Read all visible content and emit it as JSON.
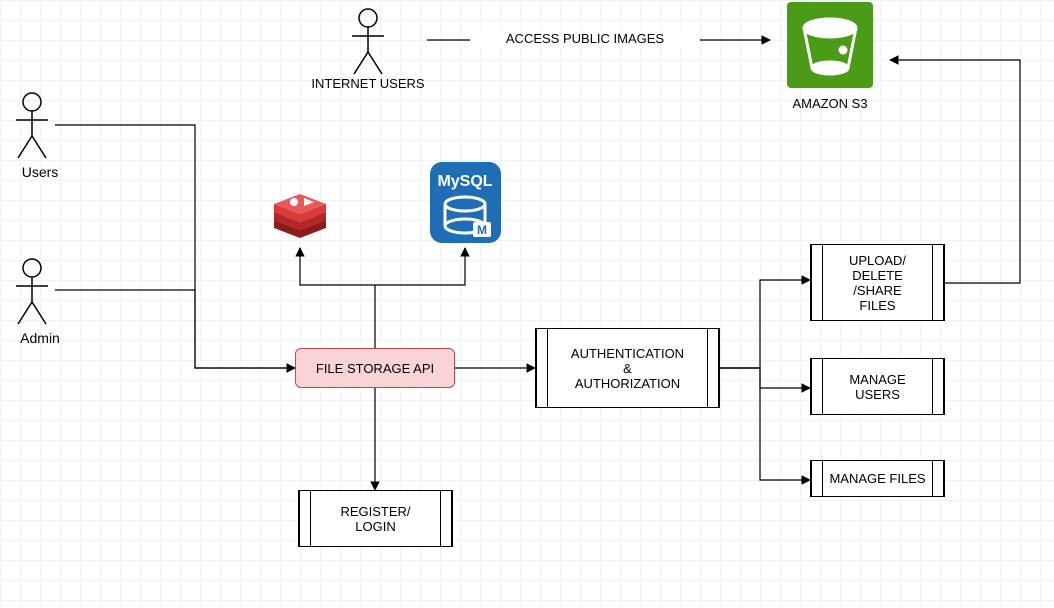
{
  "actors": {
    "users": "Users",
    "admin": "Admin",
    "internet_users": "INTERNET USERS"
  },
  "services": {
    "s3": "AMAZON S3",
    "mysql": "MySQL"
  },
  "nodes": {
    "file_storage_api": "FILE STORAGE API",
    "auth": "AUTHENTICATION\n&\nAUTHORIZATION",
    "register_login": "REGISTER/\nLOGIN",
    "upload_delete_share": "UPLOAD/\nDELETE\n/SHARE\nFILES",
    "manage_users": "MANAGE\nUSERS",
    "manage_files": "MANAGE FILES"
  },
  "edges": {
    "access_public_images": "ACCESS PUBLIC IMAGES"
  }
}
